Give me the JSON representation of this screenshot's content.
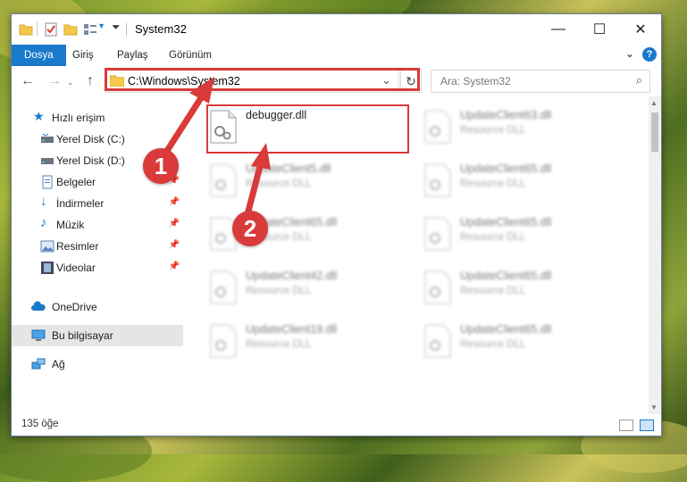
{
  "window": {
    "title": "System32"
  },
  "ribbon": {
    "tabs": [
      "Dosya",
      "Giriş",
      "Paylaş",
      "Görünüm"
    ]
  },
  "address": {
    "path": "C:\\Windows\\System32"
  },
  "search": {
    "placeholder": "Ara: System32"
  },
  "nav": {
    "items": [
      {
        "label": "Hızlı erişim",
        "icon": "star-icon",
        "pinned": false
      },
      {
        "label": "Yerel Disk (C:)",
        "icon": "drive-icon",
        "pinned": false
      },
      {
        "label": "Yerel Disk (D:)",
        "icon": "drive-icon",
        "pinned": false
      },
      {
        "label": "Belgeler",
        "icon": "documents-icon",
        "pinned": true
      },
      {
        "label": "İndirmeler",
        "icon": "download-icon",
        "pinned": true
      },
      {
        "label": "Müzik",
        "icon": "music-icon",
        "pinned": true
      },
      {
        "label": "Resimler",
        "icon": "pictures-icon",
        "pinned": true
      },
      {
        "label": "Videolar",
        "icon": "videos-icon",
        "pinned": true
      },
      {
        "label": "OneDrive",
        "icon": "cloud-icon",
        "pinned": false
      },
      {
        "label": "Bu bilgisayar",
        "icon": "computer-icon",
        "pinned": false
      },
      {
        "label": "Ağ",
        "icon": "network-icon",
        "pinned": false
      }
    ]
  },
  "files": [
    {
      "name": "debugger.dll",
      "type": ""
    },
    {
      "name": "UpdateClient63.dll",
      "type": "Resource DLL"
    },
    {
      "name": "UpdateClient5.dll",
      "type": "Resource DLL"
    },
    {
      "name": "UpdateClient65.dll",
      "type": "Resource DLL"
    },
    {
      "name": "UpdateClient65.dll",
      "type": "Resource DLL"
    },
    {
      "name": "UpdateClient65.dll",
      "type": "Resource DLL"
    },
    {
      "name": "UpdateClient42.dll",
      "type": "Resource DLL"
    },
    {
      "name": "UpdateClient65.dll",
      "type": "Resource DLL"
    },
    {
      "name": "UpdateClient19.dll",
      "type": "Resource DLL"
    },
    {
      "name": "UpdateClient65.dll",
      "type": "Resource DLL"
    }
  ],
  "status": {
    "count": "135 öğe"
  },
  "annotations": {
    "step1": "1",
    "step2": "2"
  },
  "colors": {
    "accent": "#1979ca",
    "highlight": "#d93a3a"
  }
}
